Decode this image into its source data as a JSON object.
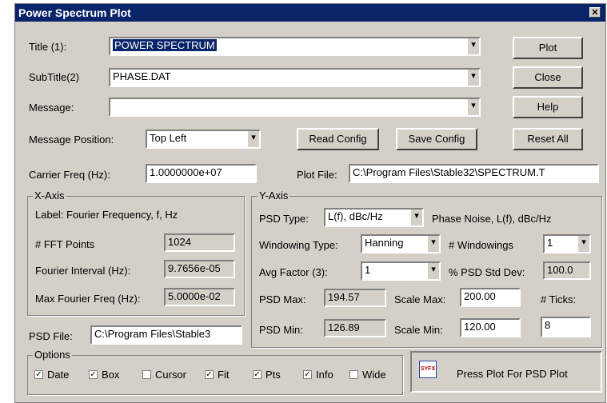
{
  "window": {
    "title": "Power Spectrum Plot",
    "close": "✕"
  },
  "fields": {
    "title_label": "Title (1):",
    "title_value": "POWER SPECTRUM",
    "subtitle_label": "SubTitle(2)",
    "subtitle_value": "PHASE.DAT",
    "message_label": "Message:",
    "message_value": "",
    "msgpos_label": "Message Position:",
    "msgpos_value": "Top Left",
    "carrier_label": "Carrier Freq (Hz):",
    "carrier_value": "1.0000000e+07",
    "plotfile_label": "Plot File:",
    "plotfile_value": "C:\\Program Files\\Stable32\\SPECTRUM.T",
    "psdfile_label": "PSD File:",
    "psdfile_value": "C:\\Program Files\\Stable3"
  },
  "buttons": {
    "plot": "Plot",
    "close": "Close",
    "help": "Help",
    "reset": "Reset All",
    "read": "Read Config",
    "save": "Save Config"
  },
  "xaxis": {
    "group": "X-Axis",
    "label": "Label: Fourier Frequency, f, Hz",
    "fft_label": "# FFT Points",
    "fft_value": "1024",
    "interval_label": "Fourier Interval (Hz):",
    "interval_value": "9.7656e-05",
    "max_label": "Max Fourier Freq (Hz):",
    "max_value": "5.0000e-02"
  },
  "yaxis": {
    "group": "Y-Axis",
    "psdtype_label": "PSD Type:",
    "psdtype_value": "L(f), dBc/Hz",
    "psdtype_desc": "Phase Noise, L(f), dBc/Hz",
    "windowing_label": "Windowing Type:",
    "windowing_value": "Hanning",
    "nwin_label": "# Windowings",
    "nwin_value": "1",
    "avg_label": "Avg Factor (3):",
    "avg_value": "1",
    "stddev_label": "% PSD Std Dev:",
    "stddev_value": "100.0",
    "psdmax_label": "PSD Max:",
    "psdmax_value": "194.57",
    "psdmin_label": "PSD Min:",
    "psdmin_value": "126.89",
    "scalemax_label": "Scale Max:",
    "scalemax_value": "200.00",
    "scalemin_label": "Scale Min:",
    "scalemin_value": "120.00",
    "ticks_label": "# Ticks:",
    "ticks_value": "8"
  },
  "options": {
    "group": "Options",
    "items": [
      {
        "label": "Date",
        "checked": "✓"
      },
      {
        "label": "Box",
        "checked": "✓"
      },
      {
        "label": "Cursor",
        "checked": ""
      },
      {
        "label": "Fit",
        "checked": "✓"
      },
      {
        "label": "Pts",
        "checked": "✓"
      },
      {
        "label": "Info",
        "checked": "✓"
      },
      {
        "label": "Wide",
        "checked": ""
      }
    ]
  },
  "status": {
    "icon_text": "SYFX",
    "text": "Press Plot For PSD Plot"
  }
}
